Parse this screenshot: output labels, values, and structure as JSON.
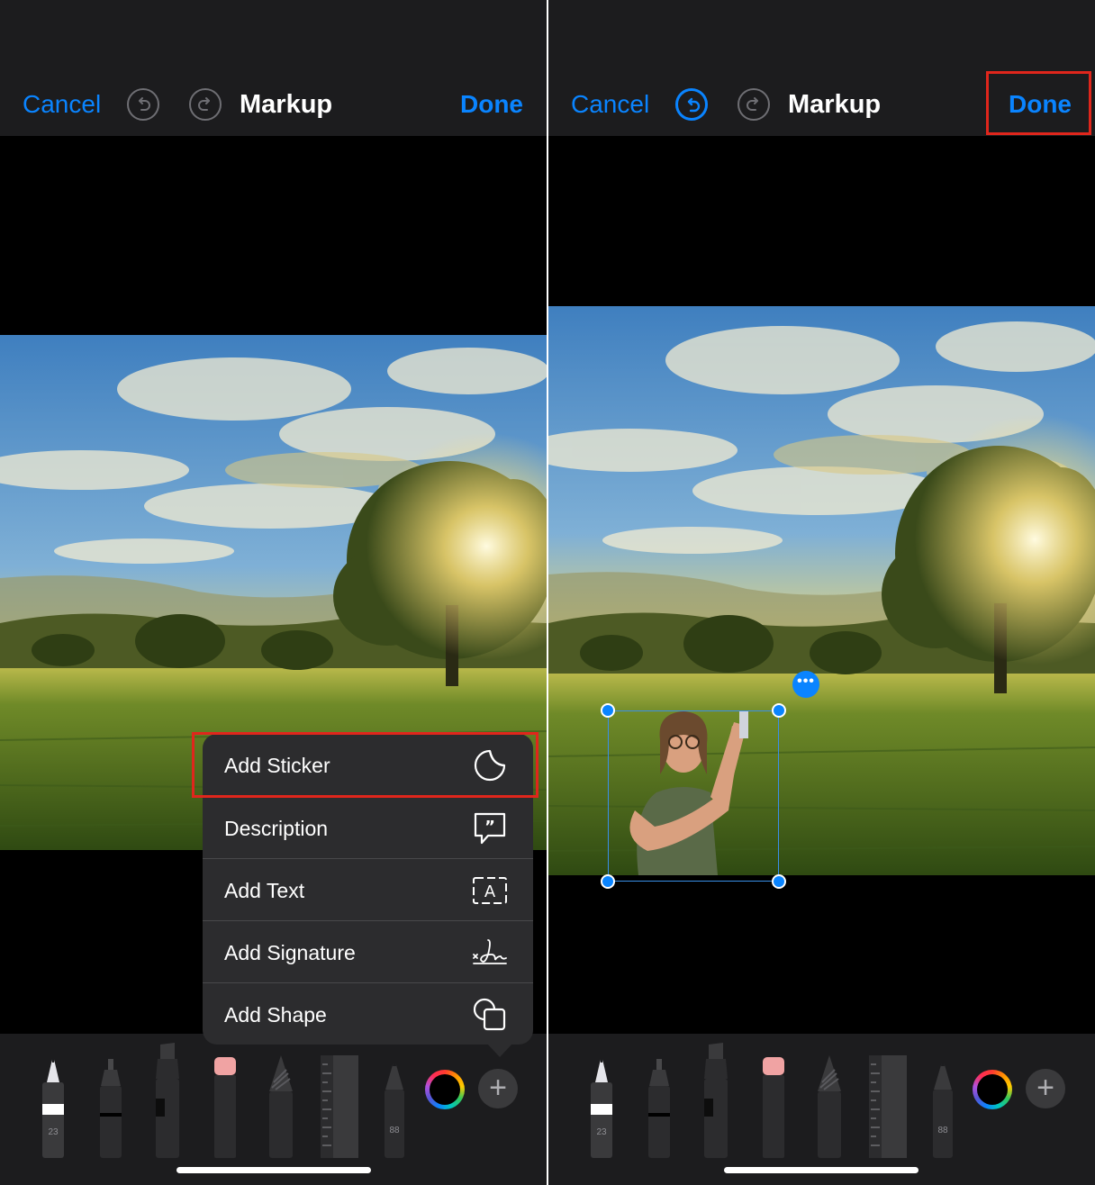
{
  "left_screen": {
    "nav": {
      "cancel": "Cancel",
      "title": "Markup",
      "done": "Done"
    },
    "menu": {
      "items": [
        {
          "label": "Add Sticker",
          "icon": "sticker-icon",
          "highlighted": true
        },
        {
          "label": "Description",
          "icon": "quote-bubble-icon"
        },
        {
          "label": "Add Text",
          "icon": "text-box-icon"
        },
        {
          "label": "Add Signature",
          "icon": "signature-icon"
        },
        {
          "label": "Add Shape",
          "icon": "shapes-icon"
        }
      ]
    },
    "tools": {
      "pen_size": "23",
      "pencil_size": "88",
      "plus": "+"
    }
  },
  "right_screen": {
    "nav": {
      "cancel": "Cancel",
      "title": "Markup",
      "done": "Done",
      "done_highlighted": true
    },
    "sticker": {
      "more": "•••",
      "description": "person sticker"
    },
    "tools": {
      "pen_size": "23",
      "pencil_size": "88",
      "plus": "+"
    }
  },
  "colors": {
    "accent": "#0a84ff",
    "highlight": "#e0261c",
    "bar": "#1c1c1e",
    "menu": "#2c2c2e"
  }
}
